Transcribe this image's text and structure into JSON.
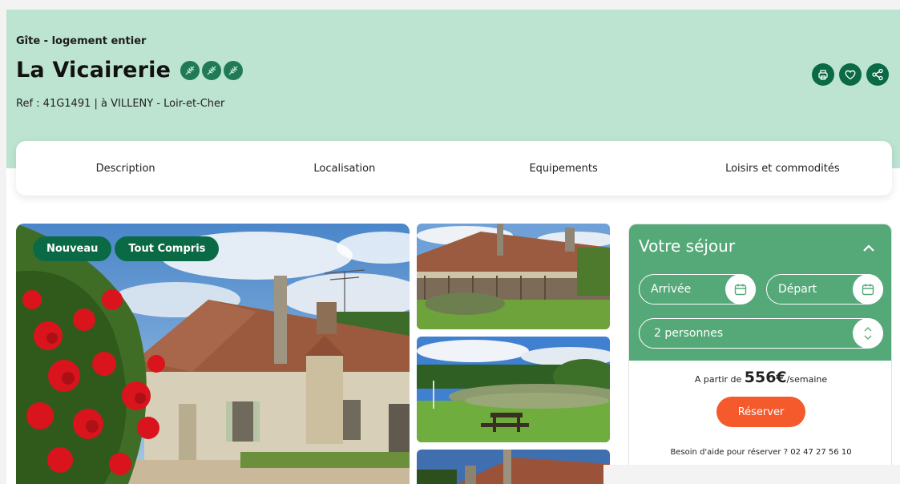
{
  "listing": {
    "kicker": "Gîte - logement entier",
    "title": "La Vicairerie",
    "epis_count": 3,
    "ref": "Ref : 41G1491 | à VILLENY - Loir-et-Cher"
  },
  "actions": [
    {
      "icon": "print-icon"
    },
    {
      "icon": "heart-icon"
    },
    {
      "icon": "share-icon"
    }
  ],
  "tabs": [
    "Description",
    "Localisation",
    "Equipements",
    "Loisirs et commodités"
  ],
  "badges": [
    "Nouveau",
    "Tout Compris"
  ],
  "booking": {
    "title": "Votre séjour",
    "arrival_placeholder": "Arrivée",
    "departure_placeholder": "Départ",
    "guests": "2 personnes",
    "price_prefix": "A partir de ",
    "price_amount": "556€",
    "price_suffix": "/semaine",
    "reserve_label": "Réserver",
    "help_text": "Besoin d'aide pour réserver ? 02 47 27 56 10"
  },
  "colors": {
    "hero_bg": "#bde3d1",
    "brand_dark": "#0b6a46",
    "booking_green": "#55a979",
    "cta_orange": "#f45a2b"
  }
}
